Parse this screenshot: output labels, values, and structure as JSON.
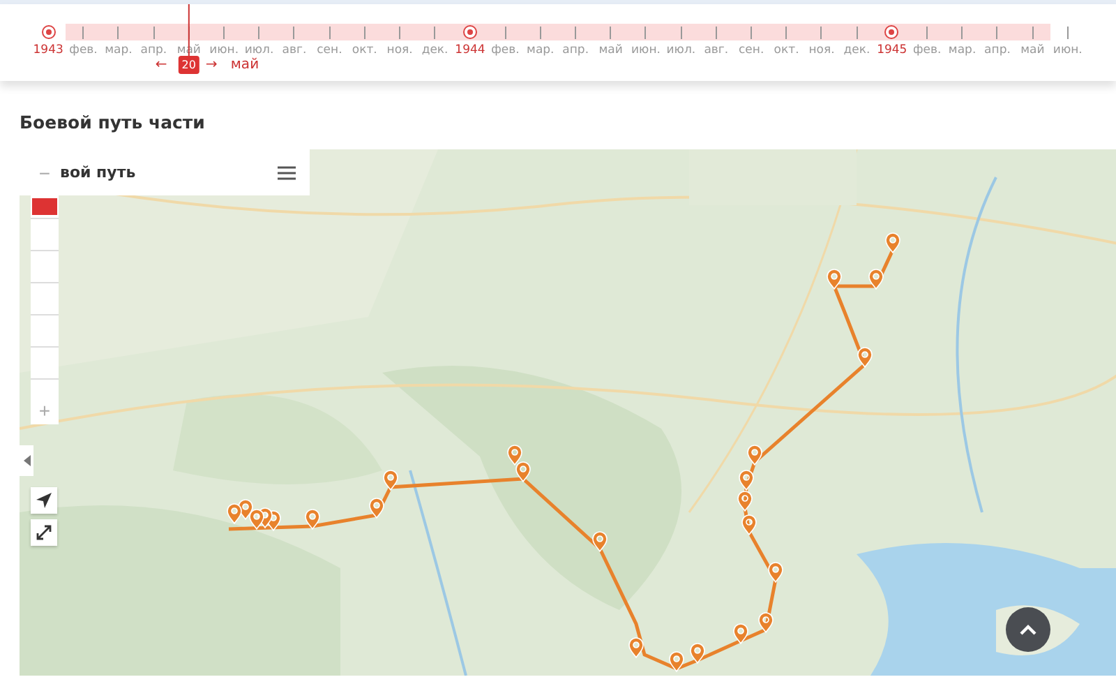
{
  "timeline": {
    "ticks": [
      {
        "label": "1943",
        "kind": "year",
        "highlighted": false,
        "selected": false
      },
      {
        "label": "фев.",
        "kind": "month",
        "highlighted": true,
        "selected": false
      },
      {
        "label": "мар.",
        "kind": "month",
        "highlighted": true,
        "selected": false
      },
      {
        "label": "апр.",
        "kind": "month",
        "highlighted": true,
        "selected": false
      },
      {
        "label": "май",
        "kind": "month",
        "highlighted": true,
        "selected": true
      },
      {
        "label": "июн.",
        "kind": "month",
        "highlighted": true,
        "selected": false
      },
      {
        "label": "июл.",
        "kind": "month",
        "highlighted": true,
        "selected": false
      },
      {
        "label": "авг.",
        "kind": "month",
        "highlighted": true,
        "selected": false
      },
      {
        "label": "сен.",
        "kind": "month",
        "highlighted": true,
        "selected": false
      },
      {
        "label": "окт.",
        "kind": "month",
        "highlighted": true,
        "selected": false
      },
      {
        "label": "ноя.",
        "kind": "month",
        "highlighted": true,
        "selected": false
      },
      {
        "label": "дек.",
        "kind": "month",
        "highlighted": true,
        "selected": false
      },
      {
        "label": "1944",
        "kind": "year",
        "highlighted": true,
        "selected": false
      },
      {
        "label": "фев.",
        "kind": "month",
        "highlighted": true,
        "selected": false
      },
      {
        "label": "мар.",
        "kind": "month",
        "highlighted": true,
        "selected": false
      },
      {
        "label": "апр.",
        "kind": "month",
        "highlighted": true,
        "selected": false
      },
      {
        "label": "май",
        "kind": "month",
        "highlighted": true,
        "selected": false
      },
      {
        "label": "июн.",
        "kind": "month",
        "highlighted": true,
        "selected": false
      },
      {
        "label": "июл.",
        "kind": "month",
        "highlighted": true,
        "selected": false
      },
      {
        "label": "авг.",
        "kind": "month",
        "highlighted": true,
        "selected": false
      },
      {
        "label": "сен.",
        "kind": "month",
        "highlighted": true,
        "selected": false
      },
      {
        "label": "окт.",
        "kind": "month",
        "highlighted": true,
        "selected": false
      },
      {
        "label": "ноя.",
        "kind": "month",
        "highlighted": true,
        "selected": false
      },
      {
        "label": "дек.",
        "kind": "month",
        "highlighted": true,
        "selected": false
      },
      {
        "label": "1945",
        "kind": "year",
        "highlighted": true,
        "selected": false
      },
      {
        "label": "фев.",
        "kind": "month",
        "highlighted": true,
        "selected": false
      },
      {
        "label": "мар.",
        "kind": "month",
        "highlighted": true,
        "selected": false
      },
      {
        "label": "апр.",
        "kind": "month",
        "highlighted": true,
        "selected": false
      },
      {
        "label": "май",
        "kind": "month",
        "highlighted": true,
        "selected": false
      },
      {
        "label": "июн.",
        "kind": "month",
        "highlighted": false,
        "selected": false
      }
    ],
    "cursor": {
      "day": "20",
      "prev": "←",
      "next": "→",
      "month": "май"
    }
  },
  "section": {
    "title": "Боевой путь части"
  },
  "map": {
    "panel": {
      "title": "вой путь"
    },
    "zoom": {
      "minus": "−",
      "plus": "+",
      "level": 0.95
    }
  }
}
